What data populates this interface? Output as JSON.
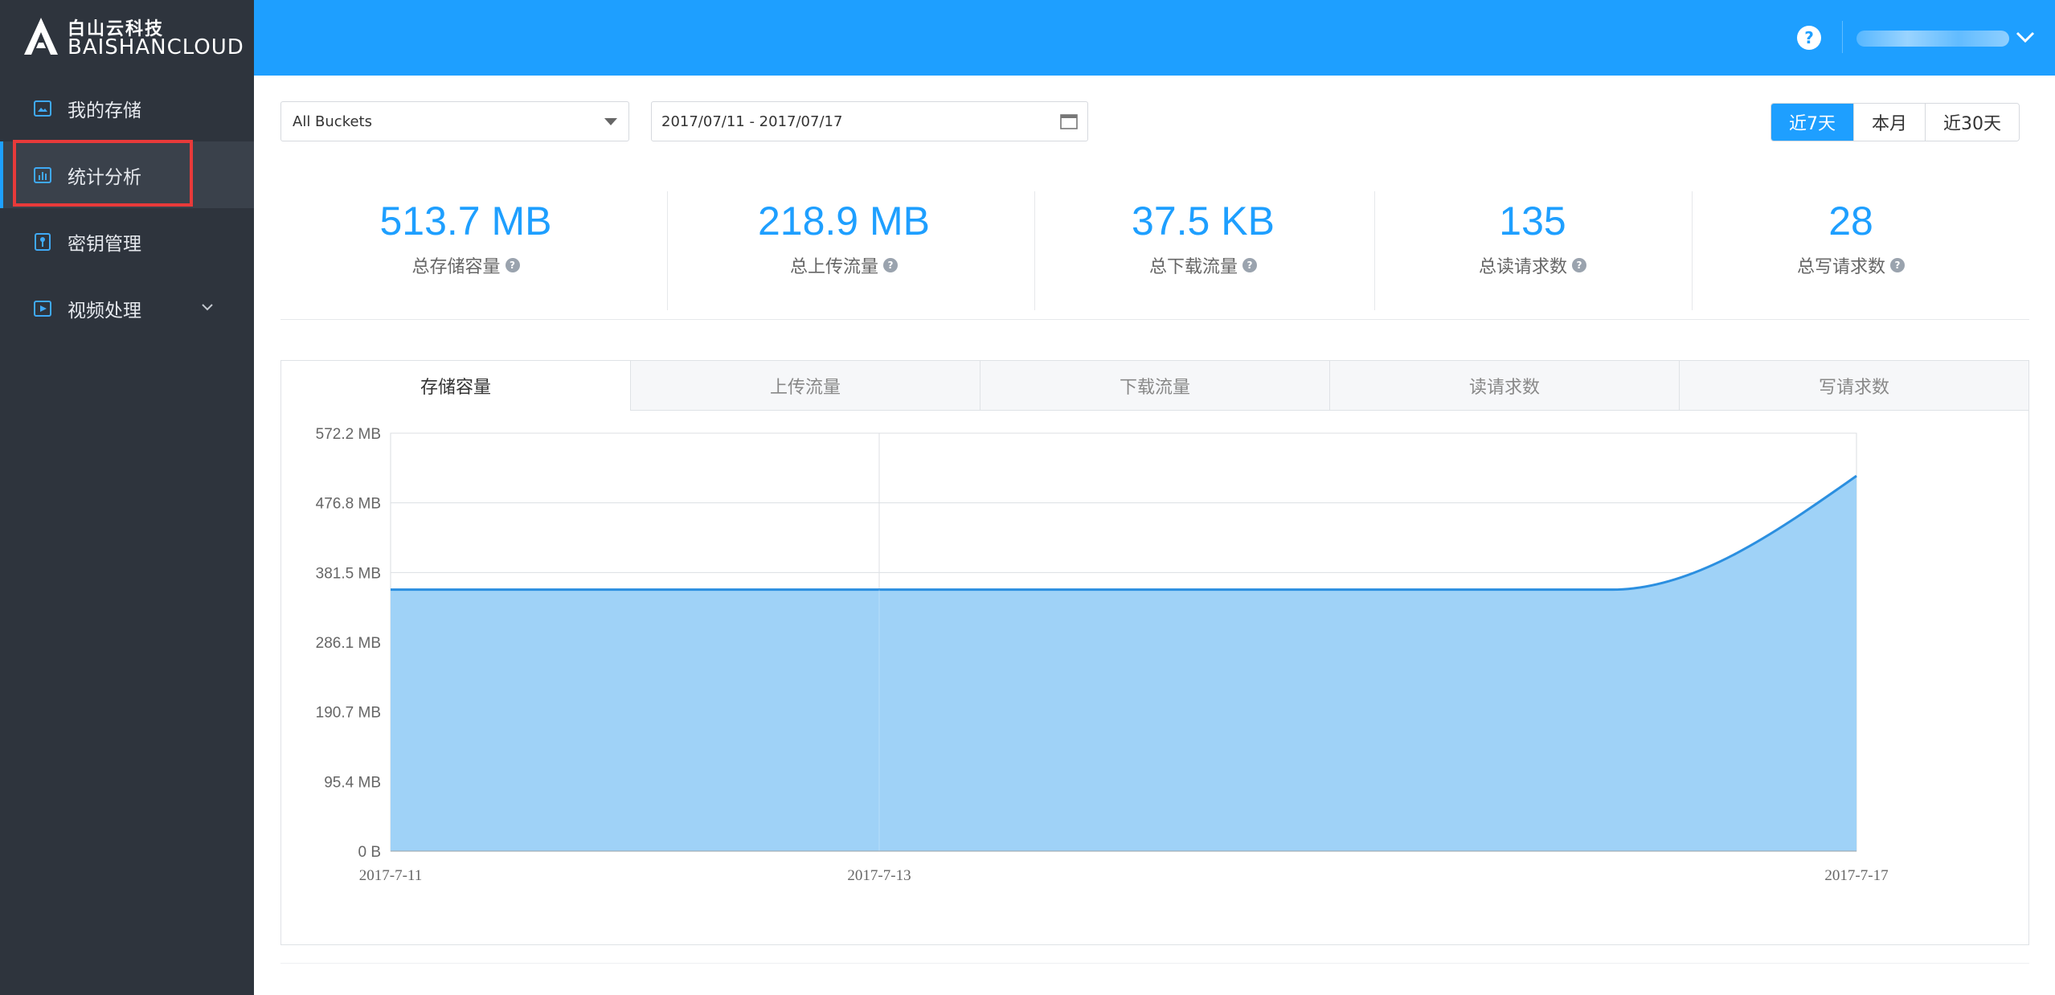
{
  "brand": {
    "name_cn": "白山云科技",
    "name_en": "BAISHANCLOUD"
  },
  "sidebar": {
    "items": [
      {
        "label": "我的存储",
        "icon": "storage-icon",
        "active": false
      },
      {
        "label": "统计分析",
        "icon": "bar-chart-icon",
        "active": true
      },
      {
        "label": "密钥管理",
        "icon": "key-icon",
        "active": false
      },
      {
        "label": "视频处理",
        "icon": "video-icon",
        "active": false,
        "has_submenu": true
      }
    ]
  },
  "header": {
    "help_glyph": "?"
  },
  "filters": {
    "bucket": "All Buckets",
    "date_range": "2017/07/11 - 2017/07/17",
    "ranges": [
      {
        "label": "近7天",
        "active": true
      },
      {
        "label": "本月",
        "active": false
      },
      {
        "label": "近30天",
        "active": false
      }
    ]
  },
  "stats": [
    {
      "value": "513.7 MB",
      "label": "总存储容量"
    },
    {
      "value": "218.9 MB",
      "label": "总上传流量"
    },
    {
      "value": "37.5 KB",
      "label": "总下载流量"
    },
    {
      "value": "135",
      "label": "总读请求数"
    },
    {
      "value": "28",
      "label": "总写请求数"
    }
  ],
  "tabs": [
    {
      "label": "存储容量",
      "active": true
    },
    {
      "label": "上传流量",
      "active": false
    },
    {
      "label": "下载流量",
      "active": false
    },
    {
      "label": "读请求数",
      "active": false
    },
    {
      "label": "写请求数",
      "active": false
    }
  ],
  "colors": {
    "accent": "#1e9fff",
    "sidebar_bg": "#2e343d",
    "area_fill": "#9fd2f7",
    "line": "#2b8fe0",
    "highlight": "#e83a3a"
  },
  "chart_data": {
    "type": "area",
    "title": "",
    "xlabel": "",
    "ylabel": "",
    "x_ticks": [
      "2017-7-11",
      "2017-7-13",
      "2017-7-17"
    ],
    "x": [
      "2017-7-11",
      "2017-7-12",
      "2017-7-13",
      "2017-7-14",
      "2017-7-15",
      "2017-7-16",
      "2017-7-17"
    ],
    "y_ticks": [
      "0 B",
      "95.4 MB",
      "190.7 MB",
      "286.1 MB",
      "381.5 MB",
      "476.8 MB",
      "572.2 MB"
    ],
    "ylim_mb": [
      0,
      572.2
    ],
    "series": [
      {
        "values_mb": [
          358,
          358,
          358,
          358,
          358,
          358,
          513.7
        ]
      }
    ],
    "grid": true
  }
}
